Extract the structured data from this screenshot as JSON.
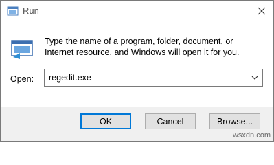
{
  "window": {
    "title": "Run",
    "app_icon": "run-dialog-icon",
    "close_icon": "close-icon"
  },
  "content": {
    "description": "Type the name of a program, folder, document, or Internet resource, and Windows will open it for you.",
    "big_icon": "run-program-icon"
  },
  "open_field": {
    "label": "Open:",
    "value": "regedit.exe",
    "dropdown_icon": "chevron-down-icon"
  },
  "buttons": {
    "ok": "OK",
    "cancel": "Cancel",
    "browse": "Browse..."
  },
  "watermark": "wsxdn.com",
  "colors": {
    "accent": "#0078d7",
    "footer_bg": "#f0f0f0",
    "button_bg": "#e1e1e1"
  }
}
